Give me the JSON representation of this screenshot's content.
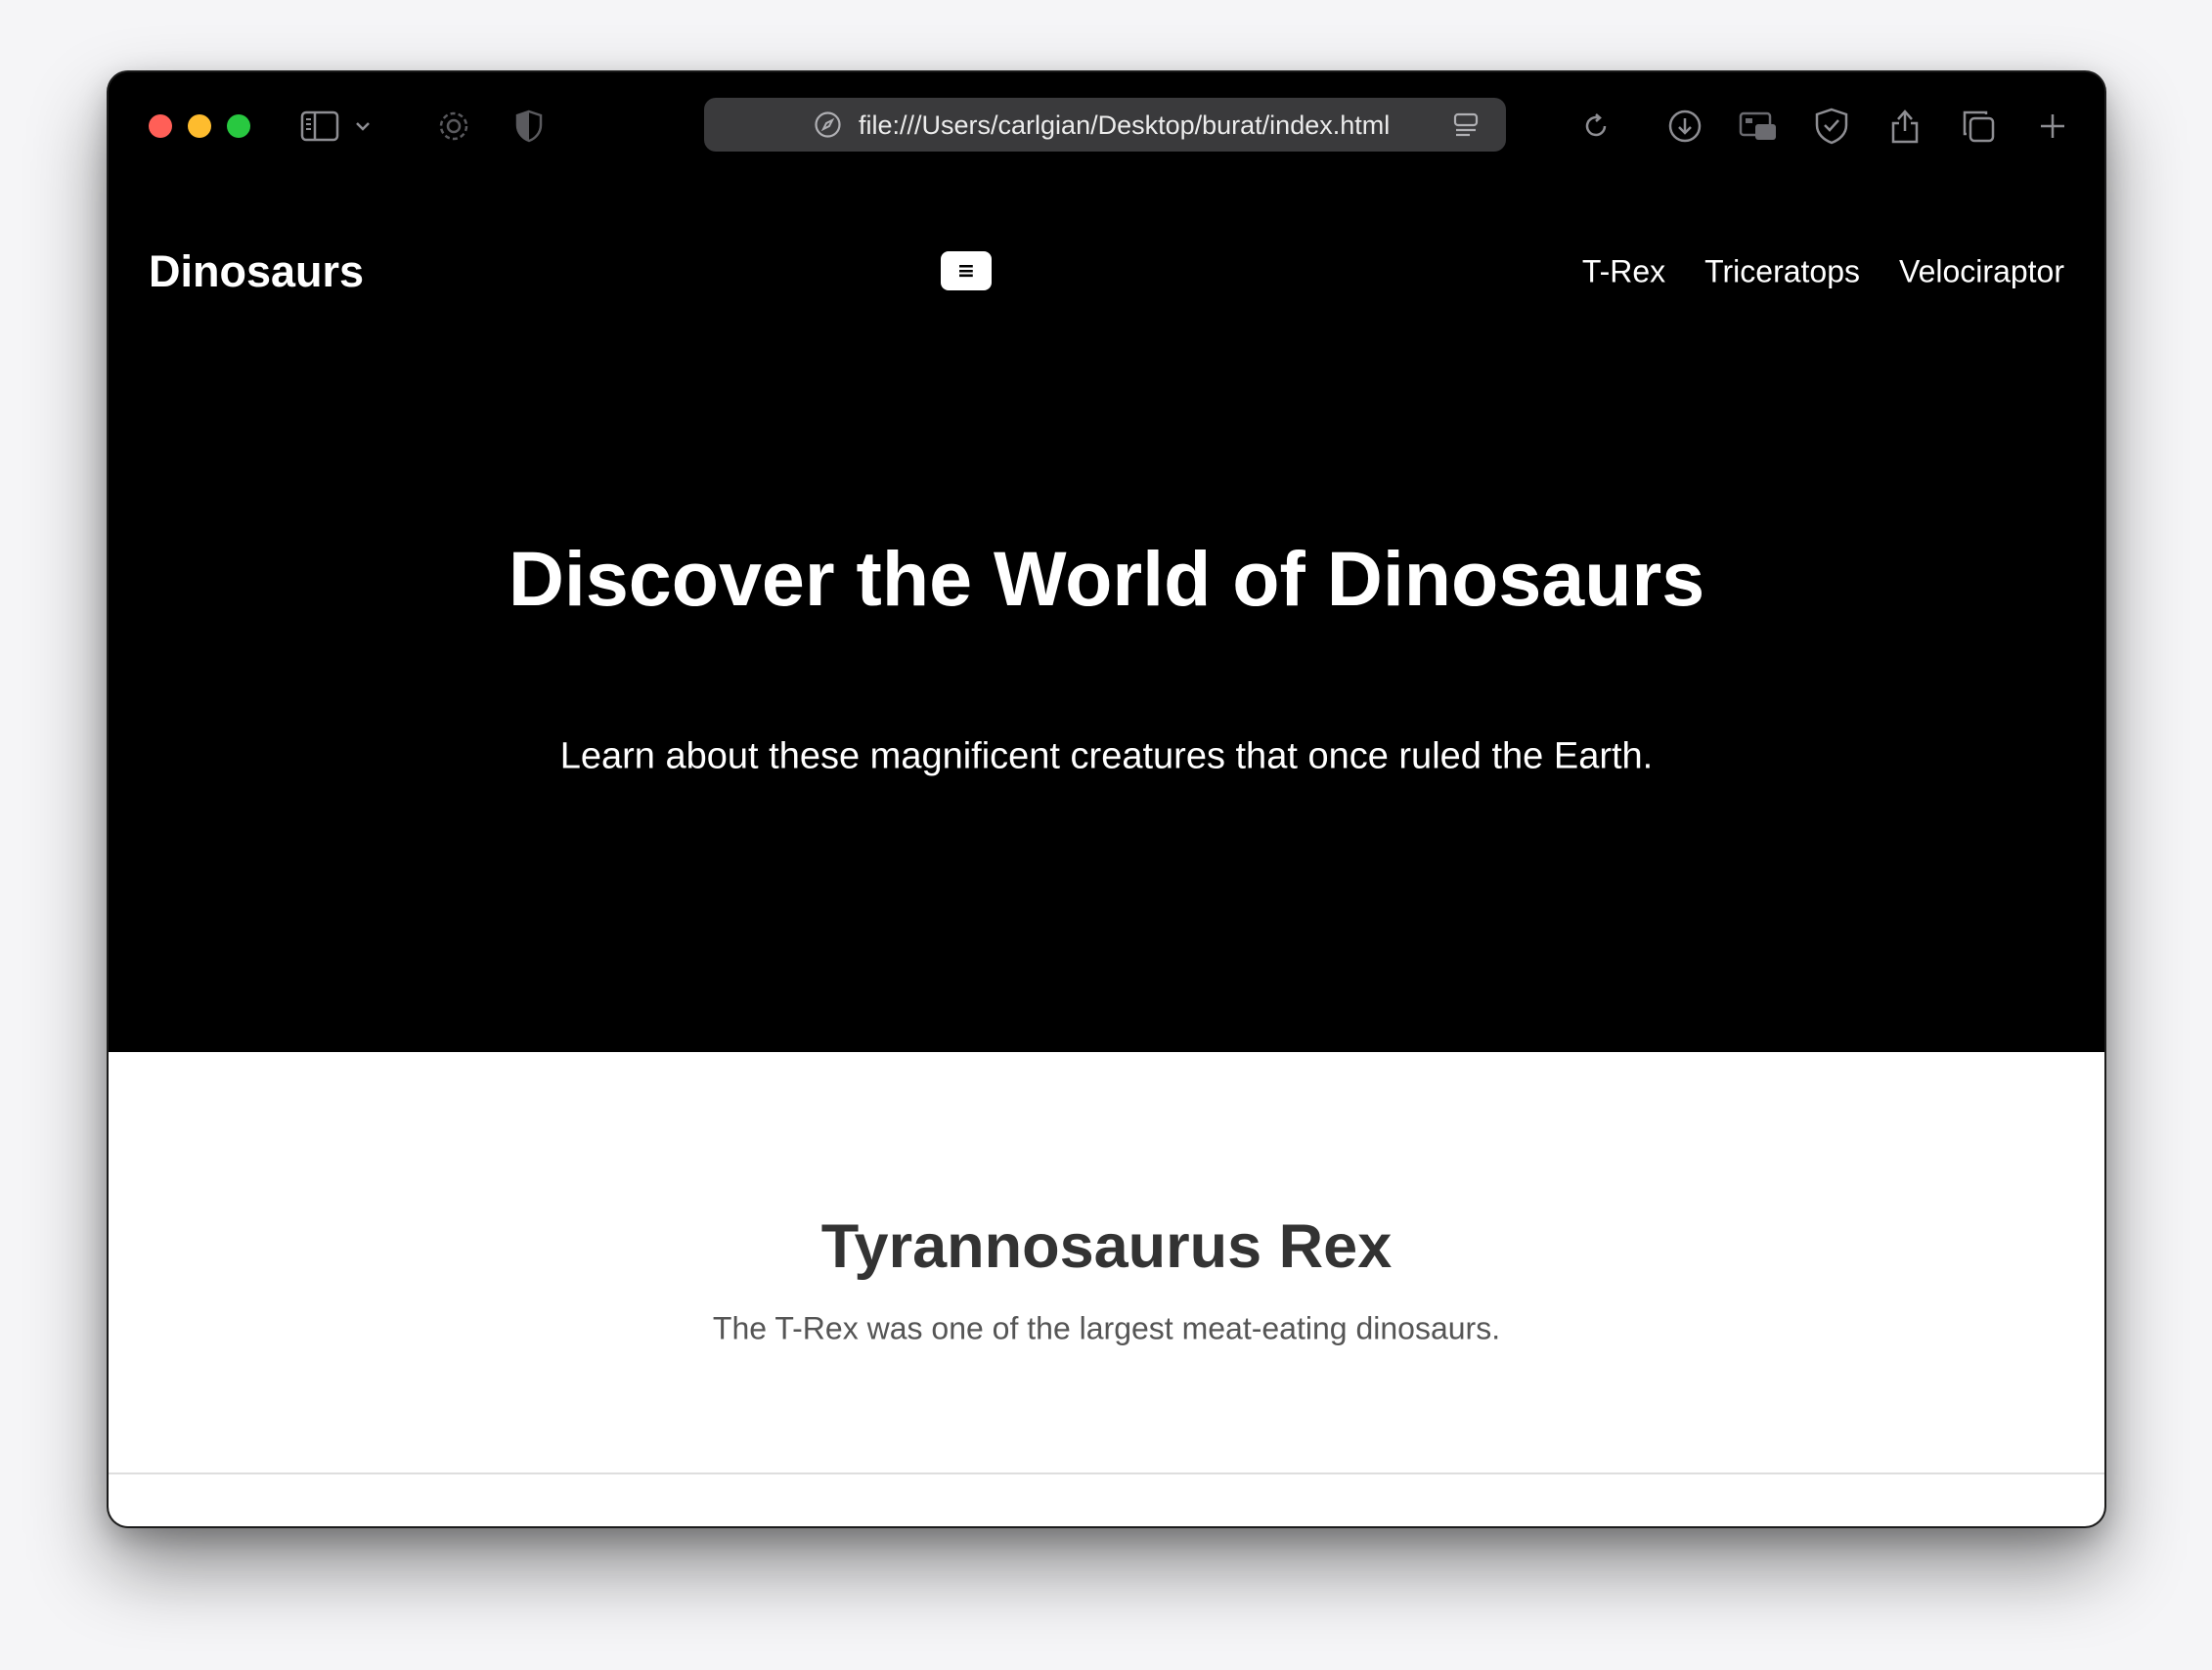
{
  "browser": {
    "url": "file:///Users/carlgian/Desktop/burat/index.html",
    "toolbar_icons_left": [
      "sidebar-icon",
      "chevron-down-icon",
      "gear-icon",
      "shield-icon"
    ],
    "toolbar_icons_right": [
      "reload-icon",
      "download-icon",
      "picture-in-picture-icon",
      "shield-check-icon",
      "share-icon",
      "tabs-icon",
      "plus-icon"
    ]
  },
  "site": {
    "brand": "Dinosaurs",
    "menu_button": "≡",
    "nav": [
      {
        "label": "T-Rex"
      },
      {
        "label": "Triceratops"
      },
      {
        "label": "Velociraptor"
      }
    ]
  },
  "hero": {
    "title": "Discover the World of Dinosaurs",
    "subtitle": "Learn about these magnificent creatures that once ruled the Earth."
  },
  "section": {
    "title": "Tyrannosaurus Rex",
    "text": "The T-Rex was one of the largest meat-eating dinosaurs."
  },
  "colors": {
    "hero_bg": "#000000",
    "section_bg": "#ffffff",
    "urlbar_bg": "#3a3a3c",
    "traffic_red": "#ff5f57",
    "traffic_yellow": "#febc2e",
    "traffic_green": "#28c840"
  }
}
